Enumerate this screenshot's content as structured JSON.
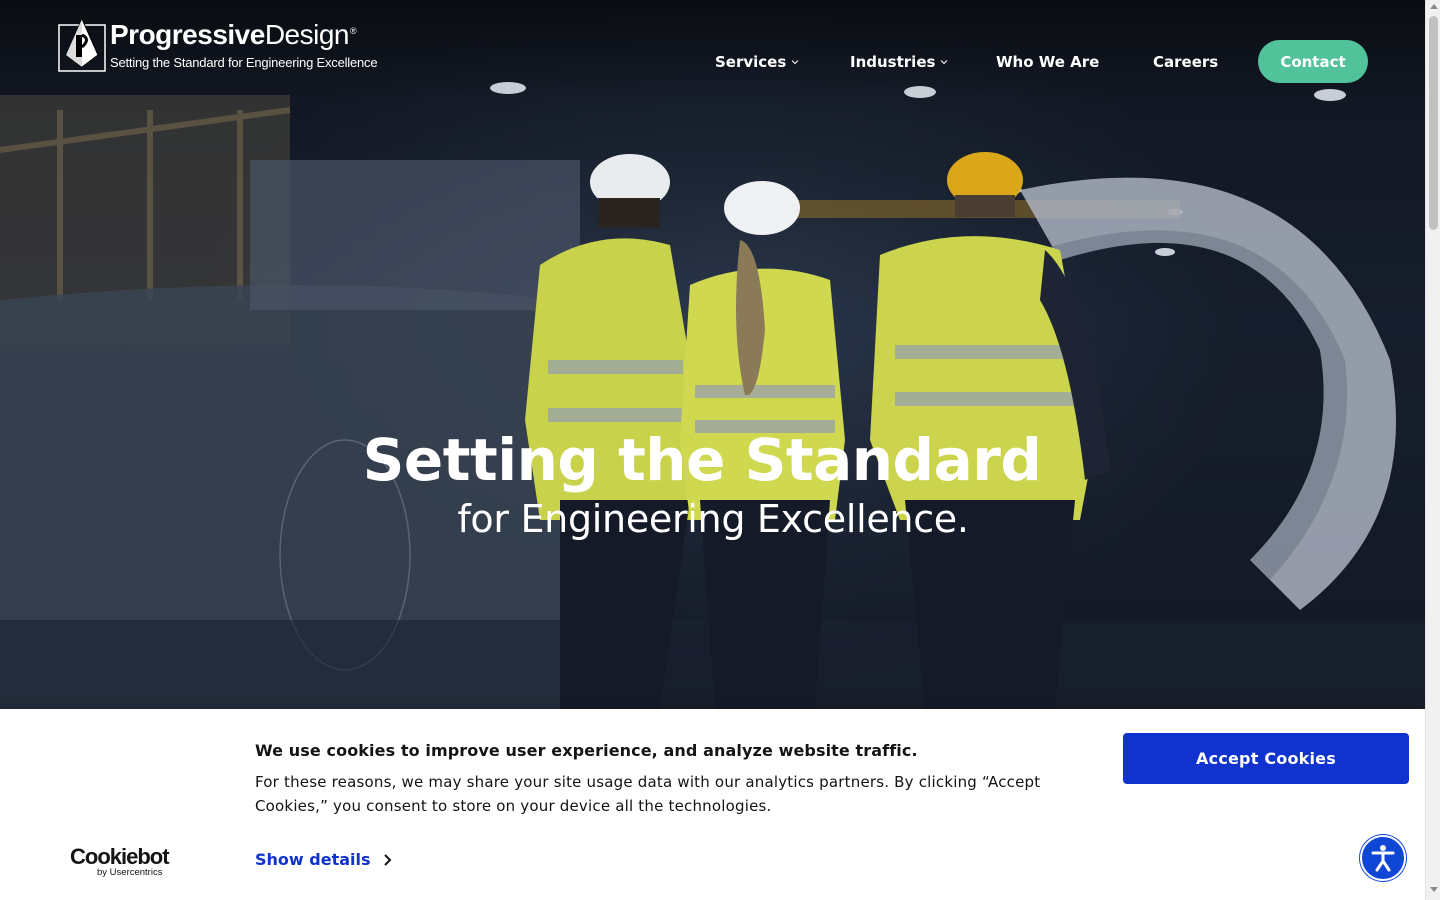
{
  "header": {
    "logo": {
      "wordmark_bold": "Progressive",
      "wordmark_light": "Design",
      "registered": "®",
      "tagline": "Setting the Standard for Engineering Excellence"
    },
    "nav": {
      "services": "Services",
      "industries": "Industries",
      "who_we_are": "Who We Are",
      "careers": "Careers",
      "contact": "Contact"
    }
  },
  "hero": {
    "title": "Setting the Standard",
    "subtitle": "for Engineering Excellence."
  },
  "cookie_banner": {
    "heading": "We use cookies to improve user experience, and analyze website traffic.",
    "body": "For these reasons, we may share your site usage data with our analytics partners. By clicking “Accept Cookies,” you consent to store on your device all the technologies.",
    "show_details": "Show details",
    "accept": "Accept Cookies",
    "provider_name": "Cookiebot",
    "provider_by": "by Usercentrics"
  },
  "colors": {
    "contact_button": "#52c29a",
    "accept_button": "#1032cf",
    "link": "#1032cf",
    "accessibility_button": "#1046d6"
  },
  "icons": {
    "services_dropdown": "chevron-down-icon",
    "industries_dropdown": "chevron-down-icon",
    "show_details_arrow": "chevron-right-icon",
    "accessibility": "accessibility-icon"
  }
}
